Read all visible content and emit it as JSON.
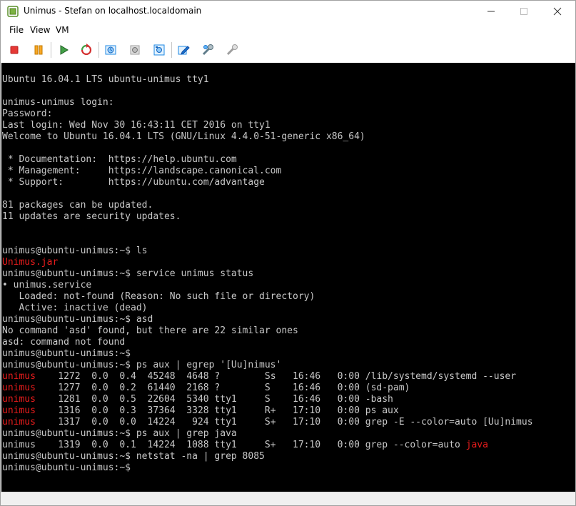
{
  "window": {
    "title": "Unimus - Stefan on localhost.localdomain"
  },
  "menu": {
    "items": [
      "File",
      "View",
      "VM"
    ]
  },
  "toolbar": {
    "buttons": [
      {
        "name": "stop",
        "icon": "stop-icon"
      },
      {
        "name": "pause",
        "icon": "pause-icon"
      },
      {
        "name": "play",
        "icon": "play-icon"
      },
      {
        "name": "reset",
        "icon": "reset-icon"
      },
      {
        "name": "snapshot",
        "icon": "snapshot-icon"
      },
      {
        "name": "revert-snapshot",
        "icon": "revert-snapshot-icon"
      },
      {
        "name": "snapshot-manager",
        "icon": "snapshot-manager-icon"
      },
      {
        "name": "edit-settings",
        "icon": "edit-settings-icon"
      },
      {
        "name": "install-tools",
        "icon": "install-tools-icon"
      },
      {
        "name": "upgrade-tools",
        "icon": "upgrade-tools-icon"
      }
    ]
  },
  "colors": {
    "console_bg": "#000000",
    "console_text": "#c8c8c8",
    "highlight_red": "#e81c1c"
  },
  "console": {
    "lines": [
      {
        "text": "Ubuntu 16.04.1 LTS ubuntu-unimus tty1"
      },
      {
        "text": ""
      },
      {
        "text": "unimus-unimus login:"
      },
      {
        "text": "Password:"
      },
      {
        "text": "Last login: Wed Nov 30 16:43:11 CET 2016 on tty1"
      },
      {
        "text": "Welcome to Ubuntu 16.04.1 LTS (GNU/Linux 4.4.0-51-generic x86_64)"
      },
      {
        "text": ""
      },
      {
        "text": " * Documentation:  https://help.ubuntu.com"
      },
      {
        "text": " * Management:     https://landscape.canonical.com"
      },
      {
        "text": " * Support:        https://ubuntu.com/advantage"
      },
      {
        "text": ""
      },
      {
        "text": "81 packages can be updated."
      },
      {
        "text": "11 updates are security updates."
      },
      {
        "text": ""
      },
      {
        "text": ""
      },
      {
        "text": "unimus@ubuntu-unimus:~$ ls"
      },
      {
        "text": "Unimus.jar",
        "red": true
      },
      {
        "text": "unimus@ubuntu-unimus:~$ service unimus status"
      },
      {
        "text": "• unimus.service"
      },
      {
        "text": "   Loaded: not-found (Reason: No such file or directory)"
      },
      {
        "text": "   Active: inactive (dead)"
      },
      {
        "text": "unimus@ubuntu-unimus:~$ asd"
      },
      {
        "text": "No command 'asd' found, but there are 22 similar ones"
      },
      {
        "text": "asd: command not found"
      },
      {
        "text": "unimus@ubuntu-unimus:~$"
      },
      {
        "text": "unimus@ubuntu-unimus:~$ ps aux | egrep '[Uu]nimus'"
      },
      {
        "red_prefix": "unimus",
        "text": "    1272  0.0  0.4  45248  4648 ?        Ss   16:46   0:00 /lib/systemd/systemd --user"
      },
      {
        "red_prefix": "unimus",
        "text": "    1277  0.0  0.2  61440  2168 ?        S    16:46   0:00 (sd-pam)"
      },
      {
        "red_prefix": "unimus",
        "text": "    1281  0.0  0.5  22604  5340 tty1     S    16:46   0:00 -bash"
      },
      {
        "red_prefix": "unimus",
        "text": "    1316  0.0  0.3  37364  3328 tty1     R+   17:10   0:00 ps aux"
      },
      {
        "red_prefix": "unimus",
        "text": "    1317  0.0  0.0  14224   924 tty1     S+   17:10   0:00 grep -E --color=auto [Uu]nimus"
      },
      {
        "text": "unimus@ubuntu-unimus:~$ ps aux | grep java"
      },
      {
        "text": "unimus    1319  0.0  0.1  14224  1088 tty1     S+   17:10   0:00 grep --color=auto ",
        "red_suffix": "java"
      },
      {
        "text": "unimus@ubuntu-unimus:~$ netstat -na | grep 8085"
      },
      {
        "text": "unimus@ubuntu-unimus:~$"
      }
    ]
  }
}
